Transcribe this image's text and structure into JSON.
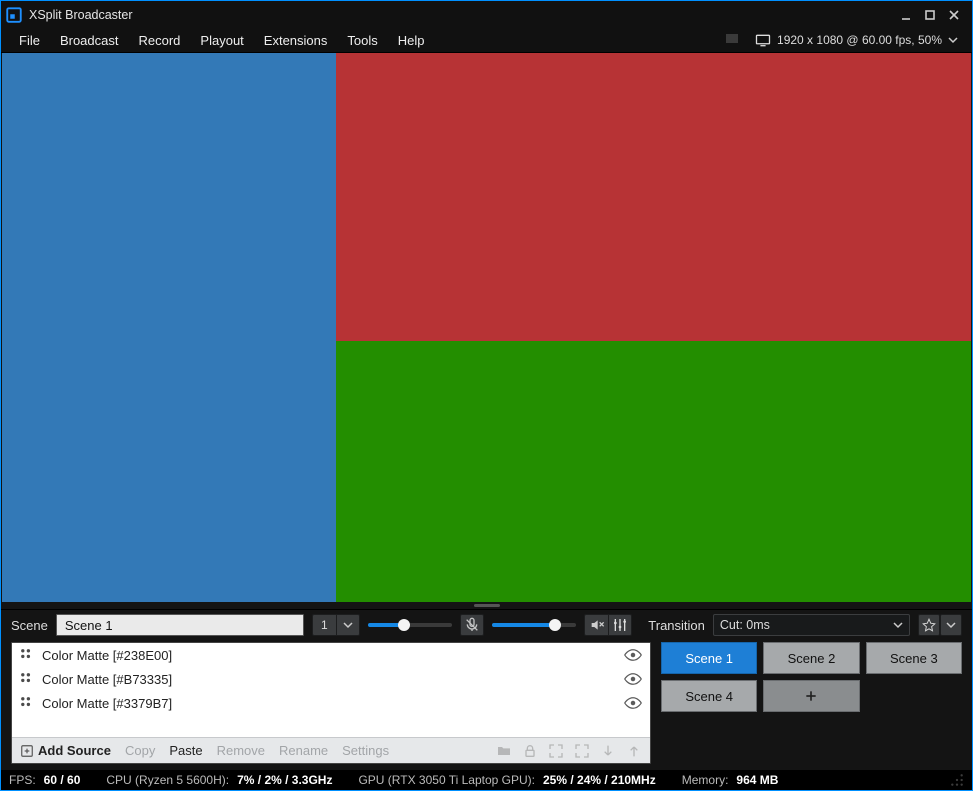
{
  "title": "XSplit Broadcaster",
  "menubar": [
    "File",
    "Broadcast",
    "Record",
    "Playout",
    "Extensions",
    "Tools",
    "Help"
  ],
  "display_info": "1920 x 1080 @ 60.00 fps, 50%",
  "colors": {
    "blue": "#3379B7",
    "red": "#B73335",
    "green": "#238E00",
    "scene_active": "#1e7fd6"
  },
  "scene_panel": {
    "label": "Scene",
    "name": "Scene 1",
    "preset_number": "1"
  },
  "audio": {
    "mic_level_pct": 43,
    "speaker_level_pct": 75
  },
  "transition": {
    "label": "Transition",
    "value": "Cut: 0ms"
  },
  "sources": [
    {
      "name": "Color Matte [#238E00]"
    },
    {
      "name": "Color Matte [#B73335]"
    },
    {
      "name": "Color Matte [#3379B7]"
    }
  ],
  "source_footer": {
    "add": "Add Source",
    "copy": "Copy",
    "paste": "Paste",
    "remove": "Remove",
    "rename": "Rename",
    "settings": "Settings"
  },
  "scenes": [
    "Scene 1",
    "Scene 2",
    "Scene 3",
    "Scene 4"
  ],
  "status": {
    "fps_label": "FPS:",
    "fps": "60 / 60",
    "cpu_label": "CPU (Ryzen 5 5600H):",
    "cpu": "7% / 2% / 3.3GHz",
    "gpu_label": "GPU (RTX 3050 Ti Laptop GPU):",
    "gpu": "25% / 24% / 210MHz",
    "mem_label": "Memory:",
    "mem": "964 MB"
  }
}
